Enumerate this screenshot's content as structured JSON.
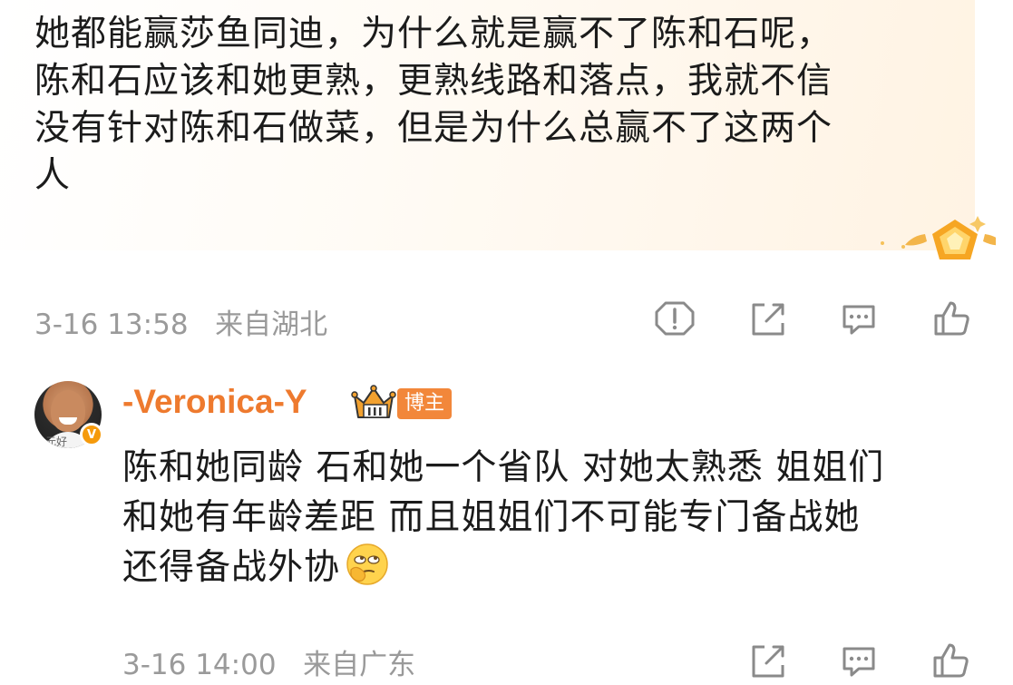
{
  "post": {
    "lines": [
      "她都能赢莎鱼同迪，为什么就是赢不了陈和石呢，",
      "陈和石应该和她更熟，更熟线路和落点，我就不信",
      "没有针对陈和石做菜，但是为什么总赢不了这两个",
      "人"
    ],
    "timestamp": "3-16 13:58",
    "location": "来自湖北",
    "actions": [
      "report-icon",
      "share-icon",
      "comment-icon",
      "like-icon"
    ]
  },
  "reply": {
    "username": "-Veronica-Y",
    "badge": "博主",
    "avatar_caption": "元好",
    "verified_mark": "V",
    "lines": [
      "陈和她同龄 石和她一个省队 对她太熟悉 姐姐们",
      "和她有年龄差距 而且姐姐们不可能专门备战她",
      "还得备战外协"
    ],
    "emoji": "thinking-eye-roll-emoji",
    "timestamp": "3-16 14:00",
    "location": "来自广东",
    "actions": [
      "share-icon",
      "comment-icon",
      "like-icon"
    ]
  },
  "colors": {
    "accent_orange": "#ee7a2e",
    "badge_orange": "#f2873a",
    "meta_gray": "#9a9a9a",
    "icon_gray": "#8a8a8a"
  }
}
